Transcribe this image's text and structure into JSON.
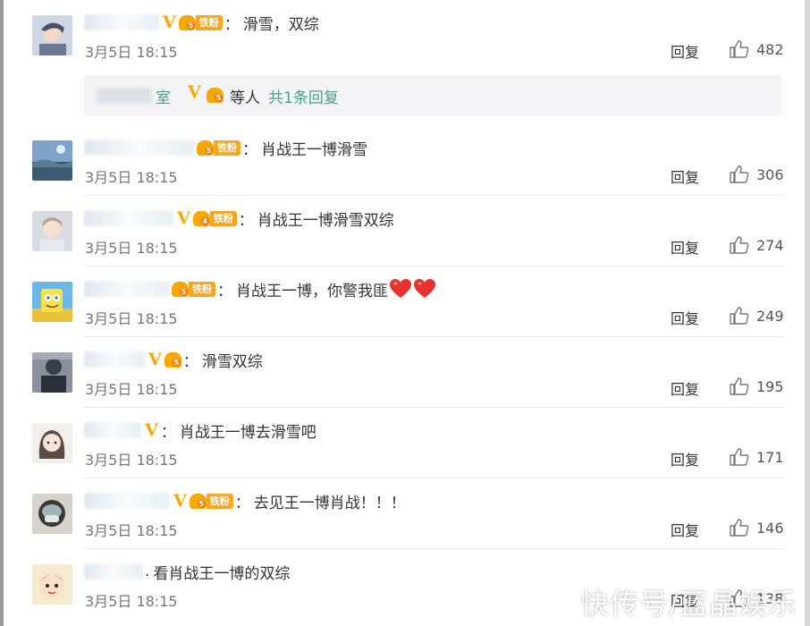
{
  "reply_label": "回复",
  "time_text": "3月5日 18:15",
  "comments": [
    {
      "name_visible": "",
      "has_v": true,
      "level": "5",
      "fan_label": "铁粉",
      "text": "滑雪，双综",
      "likes": "482",
      "avatar": "anime-boy"
    },
    {
      "name_visible": "",
      "has_v": false,
      "level": "5",
      "fan_label": "铁粉",
      "text": "肖战王一博滑雪",
      "likes": "306",
      "avatar": "sky-landscape"
    },
    {
      "name_visible": "",
      "has_v": true,
      "level": "4",
      "fan_label": "铁粉",
      "text": "肖战王一博滑雪双综",
      "likes": "274",
      "avatar": "portrait-boy"
    },
    {
      "name_visible": "",
      "has_v": false,
      "level": "5",
      "fan_label": "铁粉",
      "text": "肖战王一博，你警我匪",
      "likes": "249",
      "avatar": "spongebob",
      "hearts": 2
    },
    {
      "name_visible": "",
      "has_v": true,
      "level": "5",
      "fan_label": "",
      "text": "滑雪双综",
      "likes": "195",
      "avatar": "dark-figure"
    },
    {
      "name_visible": "",
      "has_v": true,
      "level": "",
      "fan_label": "",
      "text": "肖战王一博去滑雪吧",
      "likes": "171",
      "avatar": "drawn-girl"
    },
    {
      "name_visible": "",
      "has_v": true,
      "level": "5",
      "fan_label": "铁粉",
      "text": "去见王一博肖战！！！",
      "likes": "146",
      "avatar": "masked-face"
    },
    {
      "name_visible": "",
      "has_v": false,
      "level": "",
      "fan_label": "",
      "text": "看肖战王一博的双综",
      "likes": "138",
      "avatar": "cartoon-kid"
    }
  ],
  "reply_summary": {
    "name_tail": "室",
    "level": "5",
    "etc": "等人",
    "more": "共1条回复"
  },
  "watermark": "快传号/蓝晶娱乐",
  "colors": {
    "v_badge": "#f6a800",
    "fan_badge": "#f5a623",
    "link_green": "#4a9f8a",
    "heart": "#e8312f"
  }
}
